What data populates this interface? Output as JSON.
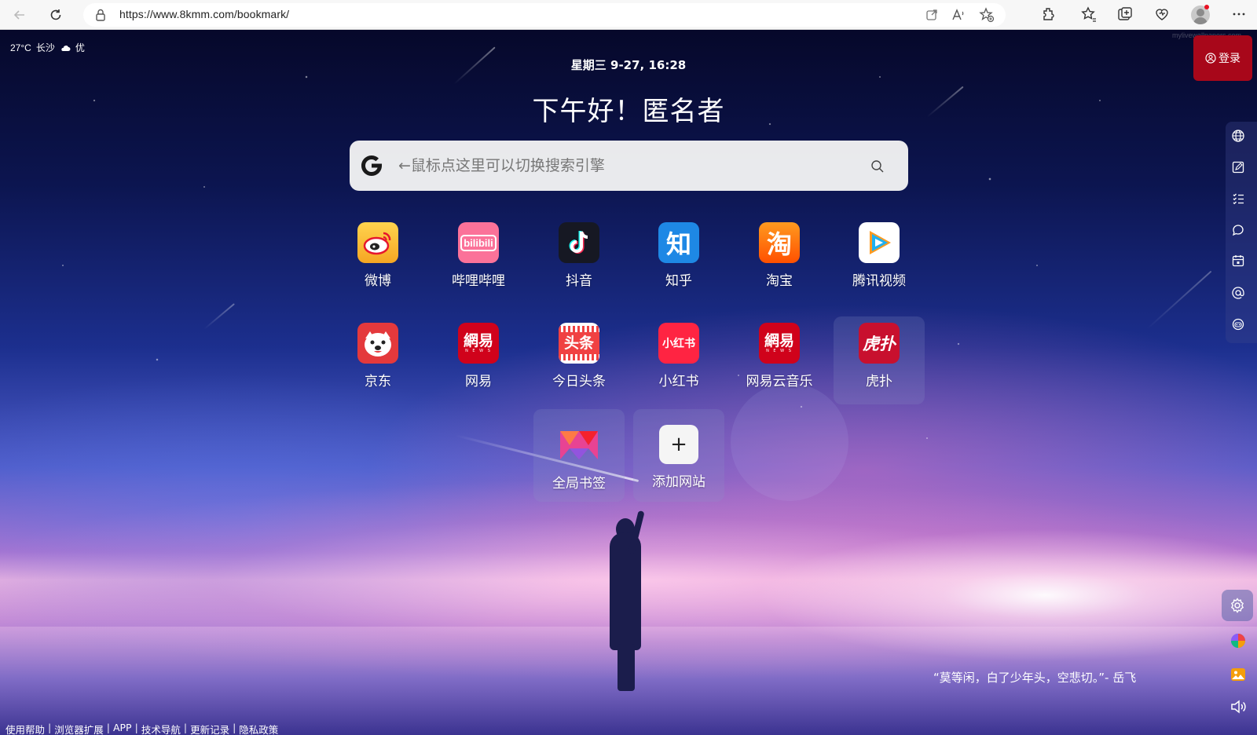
{
  "browser": {
    "url": "https://www.8kmm.com/bookmark/"
  },
  "weather": {
    "temperature": "27°C",
    "city": "长沙",
    "air_quality": "优"
  },
  "datetime": "星期三 9-27, 16:28",
  "greeting": "下午好！匿名者",
  "login_label": "登录",
  "search": {
    "placeholder": "←鼠标点这里可以切换搜索引擎"
  },
  "bookmarks": [
    {
      "label": "微博",
      "icon": "weibo-icon",
      "color": "#f5a623"
    },
    {
      "label": "哔哩哔哩",
      "icon": "bilibili-icon",
      "color": "#fb7299",
      "glyph": "bilibili"
    },
    {
      "label": "抖音",
      "icon": "douyin-icon",
      "color": "#161823"
    },
    {
      "label": "知乎",
      "icon": "zhihu-icon",
      "color": "#1e88e5",
      "glyph": "知"
    },
    {
      "label": "淘宝",
      "icon": "taobao-icon",
      "color": "#ff7a0f",
      "glyph": "淘"
    },
    {
      "label": "腾讯视频",
      "icon": "tencent-video-icon",
      "color": "#ffffff"
    },
    {
      "label": "京东",
      "icon": "jd-icon",
      "color": "#e4393c"
    },
    {
      "label": "网易",
      "icon": "netease-icon",
      "color": "#d0021b",
      "glyph": "網易"
    },
    {
      "label": "今日头条",
      "icon": "toutiao-icon",
      "color": "#f04142",
      "glyph": "头条"
    },
    {
      "label": "小红书",
      "icon": "xiaohongshu-icon",
      "color": "#ff2442",
      "glyph": "小红书"
    },
    {
      "label": "网易云音乐",
      "icon": "netease-music-icon",
      "color": "#d0021b",
      "glyph": "網易"
    },
    {
      "label": "虎扑",
      "icon": "hupu-icon",
      "color": "#c8102e",
      "glyph": "虎扑"
    },
    {
      "label": "全局书签",
      "icon": "global-bookmark-icon",
      "color": "#e84393"
    },
    {
      "label": "添加网站",
      "icon": "plus-icon",
      "color": "#f5f5f5",
      "glyph": "+"
    }
  ],
  "quote": "“莫等闲，白了少年头，空悲切。”- 岳飞",
  "footer_links": [
    "使用帮助",
    "浏览器扩展",
    "APP",
    "技术导航",
    "更新记录",
    "隐私政策"
  ],
  "watermark": "mylivewallpapers.com"
}
